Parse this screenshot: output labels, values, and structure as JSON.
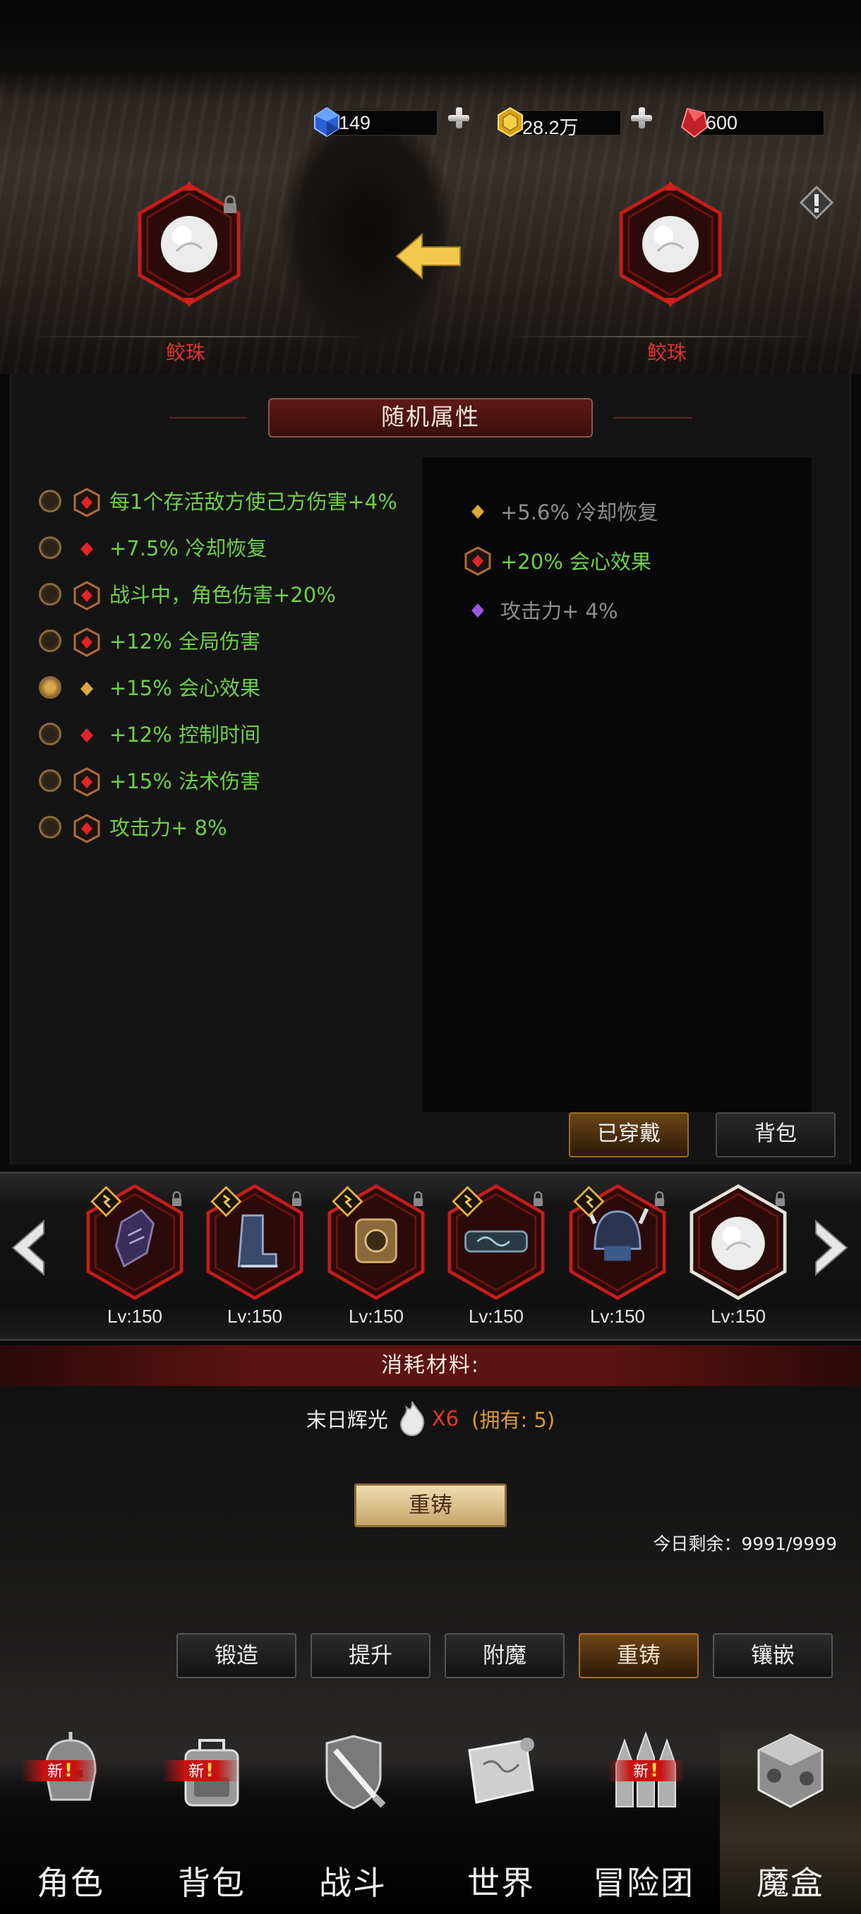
{
  "currency": {
    "diamond": "149",
    "gold": "28.2万",
    "ruby": "600"
  },
  "pearl_left_label": "鲛珠",
  "pearl_right_label": "鲛珠",
  "section_title": "随机属性",
  "attributes": [
    {
      "text": "每1个存活敌方使己方伤害+4%",
      "icon": "red-hex-gem-icon",
      "checked": false
    },
    {
      "text": "+7.5% 冷却恢复",
      "icon": "red-small-gem-icon",
      "checked": false
    },
    {
      "text": "战斗中，角色伤害+20%",
      "icon": "red-hex-gem-icon",
      "checked": false
    },
    {
      "text": "+12% 全局伤害",
      "icon": "red-hex-gem-icon",
      "checked": false
    },
    {
      "text": "+15% 会心效果",
      "icon": "gold-small-gem-icon",
      "checked": true
    },
    {
      "text": "+12% 控制时间",
      "icon": "red-small-gem-icon",
      "checked": false
    },
    {
      "text": "+15% 法术伤害",
      "icon": "red-hex-gem-icon",
      "checked": false
    },
    {
      "text": "攻击力+ 8%",
      "icon": "red-hex-gem-icon",
      "checked": false
    }
  ],
  "current_attributes": [
    {
      "text": "+5.6% 冷却恢复",
      "icon": "gold-small-gem-icon",
      "color": "grey"
    },
    {
      "text": "+20% 会心效果",
      "icon": "red-hex-gem-icon",
      "color": "green"
    },
    {
      "text": "攻击力+ 4%",
      "icon": "purple-small-gem-icon",
      "color": "grey"
    }
  ],
  "tabs": {
    "equipped": "已穿戴",
    "backpack": "背包"
  },
  "equipment": [
    {
      "name": "gauntlet",
      "level": "Lv:150"
    },
    {
      "name": "boots",
      "level": "Lv:150"
    },
    {
      "name": "ring",
      "level": "Lv:150"
    },
    {
      "name": "belt",
      "level": "Lv:150"
    },
    {
      "name": "helmet",
      "level": "Lv:150"
    },
    {
      "name": "pearl",
      "level": "Lv:150"
    }
  ],
  "consume": {
    "title": "消耗材料:",
    "material": "末日辉光",
    "qty": "X6",
    "own": "(拥有: 5)"
  },
  "reforge_button": "重铸",
  "remaining": "今日剩余：9991/9999",
  "functions": [
    "锻造",
    "提升",
    "附魔",
    "重铸",
    "镶嵌"
  ],
  "nav": {
    "new_text": "新",
    "items": [
      "角色",
      "背包",
      "战斗",
      "世界",
      "冒险团",
      "魔盒"
    ]
  }
}
